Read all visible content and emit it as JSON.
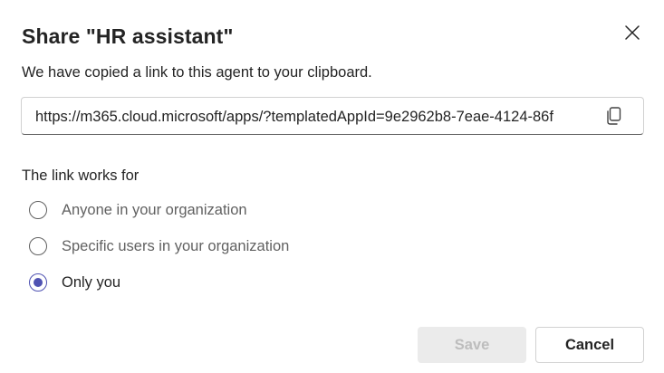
{
  "dialog": {
    "title": "Share \"HR assistant\"",
    "subtitle": "We have copied a link to this agent to your clipboard.",
    "link_value": "https://m365.cloud.microsoft/apps/?templatedAppId=9e2962b8-7eae-4124-86f",
    "section_label": "The link works for",
    "options": [
      {
        "label": "Anyone in your organization",
        "selected": false
      },
      {
        "label": "Specific users in your organization",
        "selected": false
      },
      {
        "label": "Only you",
        "selected": true
      }
    ],
    "save_label": "Save",
    "cancel_label": "Cancel"
  },
  "icons": {
    "close": "close-icon",
    "copy": "copy-icon"
  },
  "colors": {
    "accent": "#4f52b2",
    "text": "#242424",
    "muted": "#616161",
    "disabled_bg": "#ebebeb",
    "disabled_text": "#bdbdbd"
  }
}
